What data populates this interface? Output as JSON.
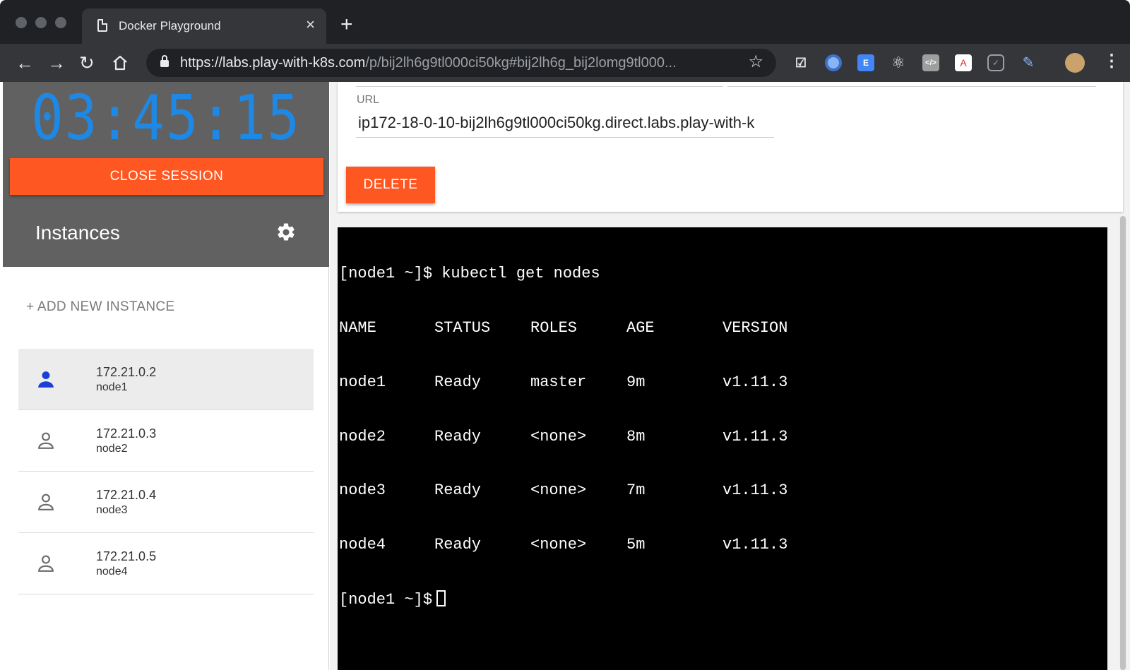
{
  "browser": {
    "tab_title": "Docker Playground",
    "tab_close": "×",
    "new_tab": "+",
    "url_host": "https://labs.play-with-k8s.com",
    "url_path": "/p/bij2lh6g9tl000ci50kg#bij2lh6g_bij2lomg9tl000...",
    "back": "←",
    "forward": "→",
    "reload": "↻",
    "star": "☆",
    "menu": "⋮",
    "extension_icons": [
      "mail-check-icon",
      "circle-extension-icon",
      "translate-icon",
      "react-devtools-icon",
      "code-icon",
      "pdf-icon",
      "pocket-icon",
      "pen-icon",
      "profile-avatar-icon"
    ]
  },
  "sidebar": {
    "timer": "03:45:15",
    "close_session": "CLOSE SESSION",
    "instances_title": "Instances",
    "add_instance": "+ ADD NEW INSTANCE",
    "instances": [
      {
        "ip": "172.21.0.2",
        "name": "node1",
        "active": true
      },
      {
        "ip": "172.21.0.3",
        "name": "node2",
        "active": false
      },
      {
        "ip": "172.21.0.4",
        "name": "node3",
        "active": false
      },
      {
        "ip": "172.21.0.5",
        "name": "node4",
        "active": false
      }
    ]
  },
  "main": {
    "url_label": "URL",
    "url_value": "ip172-18-0-10-bij2lh6g9tl000ci50kg.direct.labs.play-with-k",
    "delete": "DELETE",
    "terminal": {
      "prompt1": "[node1 ~]$ kubectl get nodes",
      "headers": [
        "NAME",
        "STATUS",
        "ROLES",
        "AGE",
        "VERSION"
      ],
      "rows": [
        [
          "node1",
          "Ready",
          "master",
          "9m",
          "v1.11.3"
        ],
        [
          "node2",
          "Ready",
          "<none>",
          "8m",
          "v1.11.3"
        ],
        [
          "node3",
          "Ready",
          "<none>",
          "7m",
          "v1.11.3"
        ],
        [
          "node4",
          "Ready",
          "<none>",
          "5m",
          "v1.11.3"
        ]
      ],
      "prompt2": "[node1 ~]$"
    }
  },
  "colors": {
    "accent": "#ff5722",
    "timer": "#1e88e5",
    "active_user": "#1a3fd6",
    "inactive_user": "#6b6b6b"
  }
}
